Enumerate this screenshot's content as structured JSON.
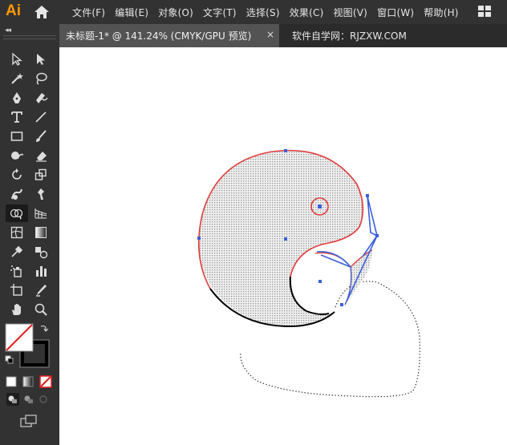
{
  "app": {
    "logo": "Ai"
  },
  "menu": [
    "文件(F)",
    "编辑(E)",
    "对象(O)",
    "文字(T)",
    "选择(S)",
    "效果(C)",
    "视图(V)",
    "窗口(W)",
    "帮助(H)"
  ],
  "tabs": {
    "active_title": "未标题-1* @ 141.24% (CMYK/GPU 预览)",
    "close_glyph": "×",
    "second": "软件自学网：RJZXW.COM"
  },
  "toolbar": {
    "collapse_glyph": "◂◂"
  },
  "colors": {
    "accent_red": "#e03a3a",
    "anchor_blue": "#3a5fd9",
    "fill_pattern": "#b8b8b8",
    "panel_bg": "#323232",
    "canvas_bg": "#ffffff"
  },
  "tools": [
    "selection-tool-icon",
    "direct-selection-tool-icon",
    "magic-wand-tool-icon",
    "lasso-tool-icon",
    "pen-tool-icon",
    "curvature-tool-icon",
    "type-tool-icon",
    "line-segment-tool-icon",
    "rectangle-tool-icon",
    "paintbrush-tool-icon",
    "shaper-tool-icon",
    "eraser-tool-icon",
    "rotate-tool-icon",
    "scale-tool-icon",
    "warp-tool-icon",
    "puppet-warp-tool-icon",
    "shape-builder-tool-icon",
    "perspective-grid-tool-icon",
    "mesh-tool-icon",
    "gradient-tool-icon",
    "eyedropper-tool-icon",
    "blend-tool-icon",
    "symbol-sprayer-tool-icon",
    "column-graph-tool-icon",
    "artboard-tool-icon",
    "slice-tool-icon",
    "hand-tool-icon",
    "zoom-tool-icon"
  ]
}
